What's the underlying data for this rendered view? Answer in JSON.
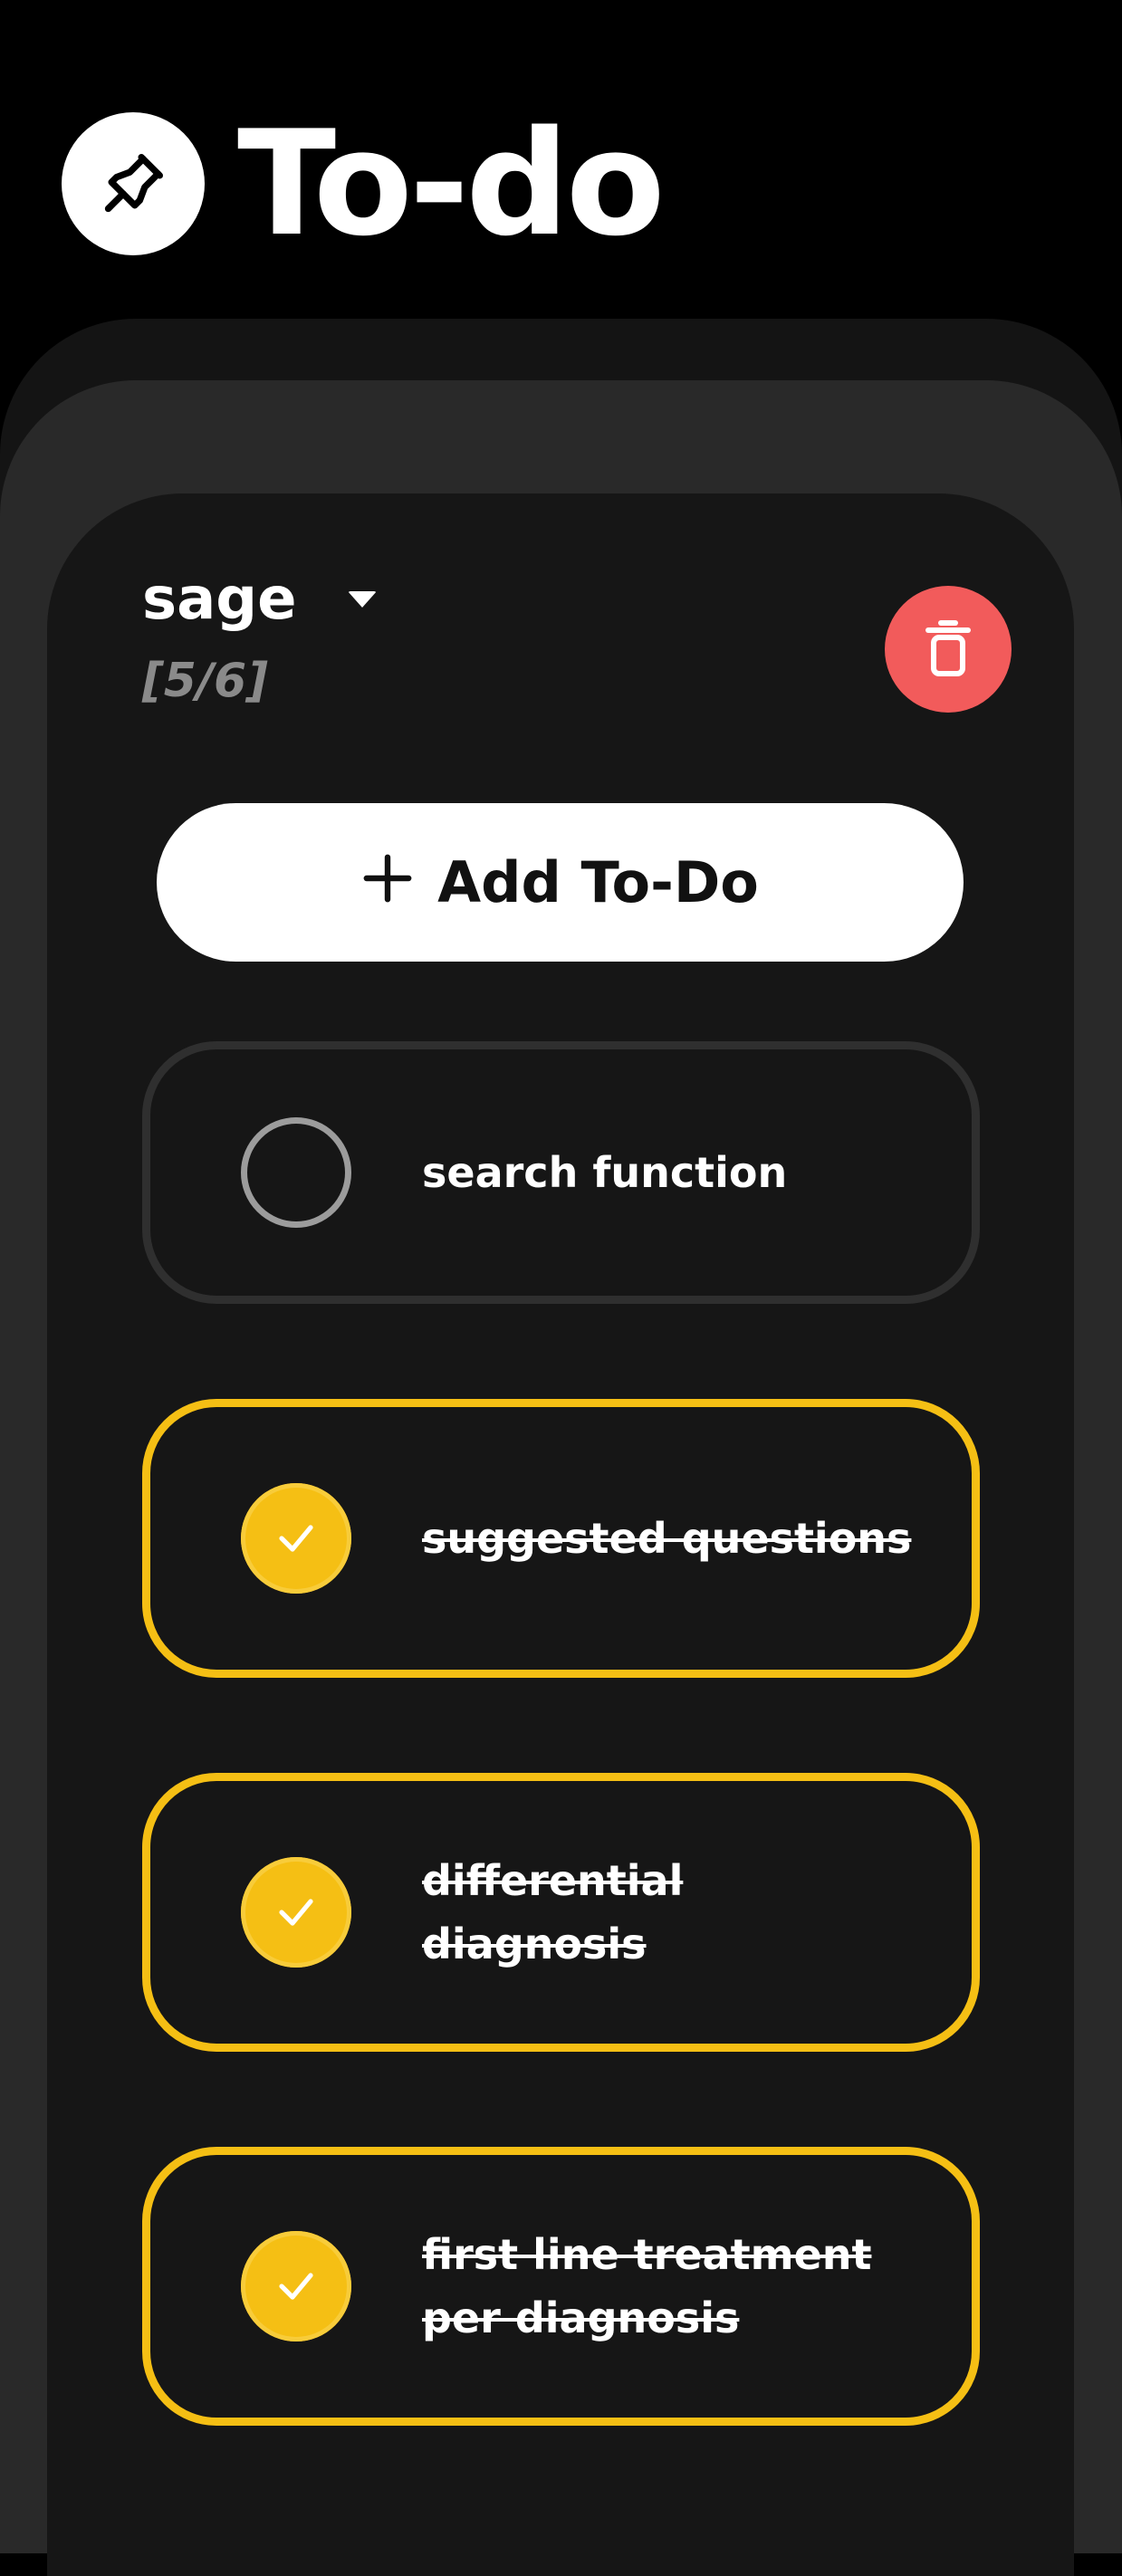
{
  "app": {
    "title": "To-do",
    "icon": "pushpin-icon"
  },
  "list": {
    "name": "sage",
    "progress": "[5/6]",
    "delete_icon": "trash-icon"
  },
  "add_button": {
    "icon": "plus-icon",
    "label": "Add To-Do"
  },
  "todos": [
    {
      "text": "search function",
      "done": false
    },
    {
      "text": "suggested questions",
      "done": true
    },
    {
      "text": "differential diagnosis",
      "done": true
    },
    {
      "text": "first line treatment per diagnosis",
      "done": true
    }
  ],
  "colors": {
    "background": "#000000",
    "accent": "#f5bf14",
    "danger": "#f25b5b",
    "card": "#161616",
    "muted": "#8a8a8a"
  }
}
